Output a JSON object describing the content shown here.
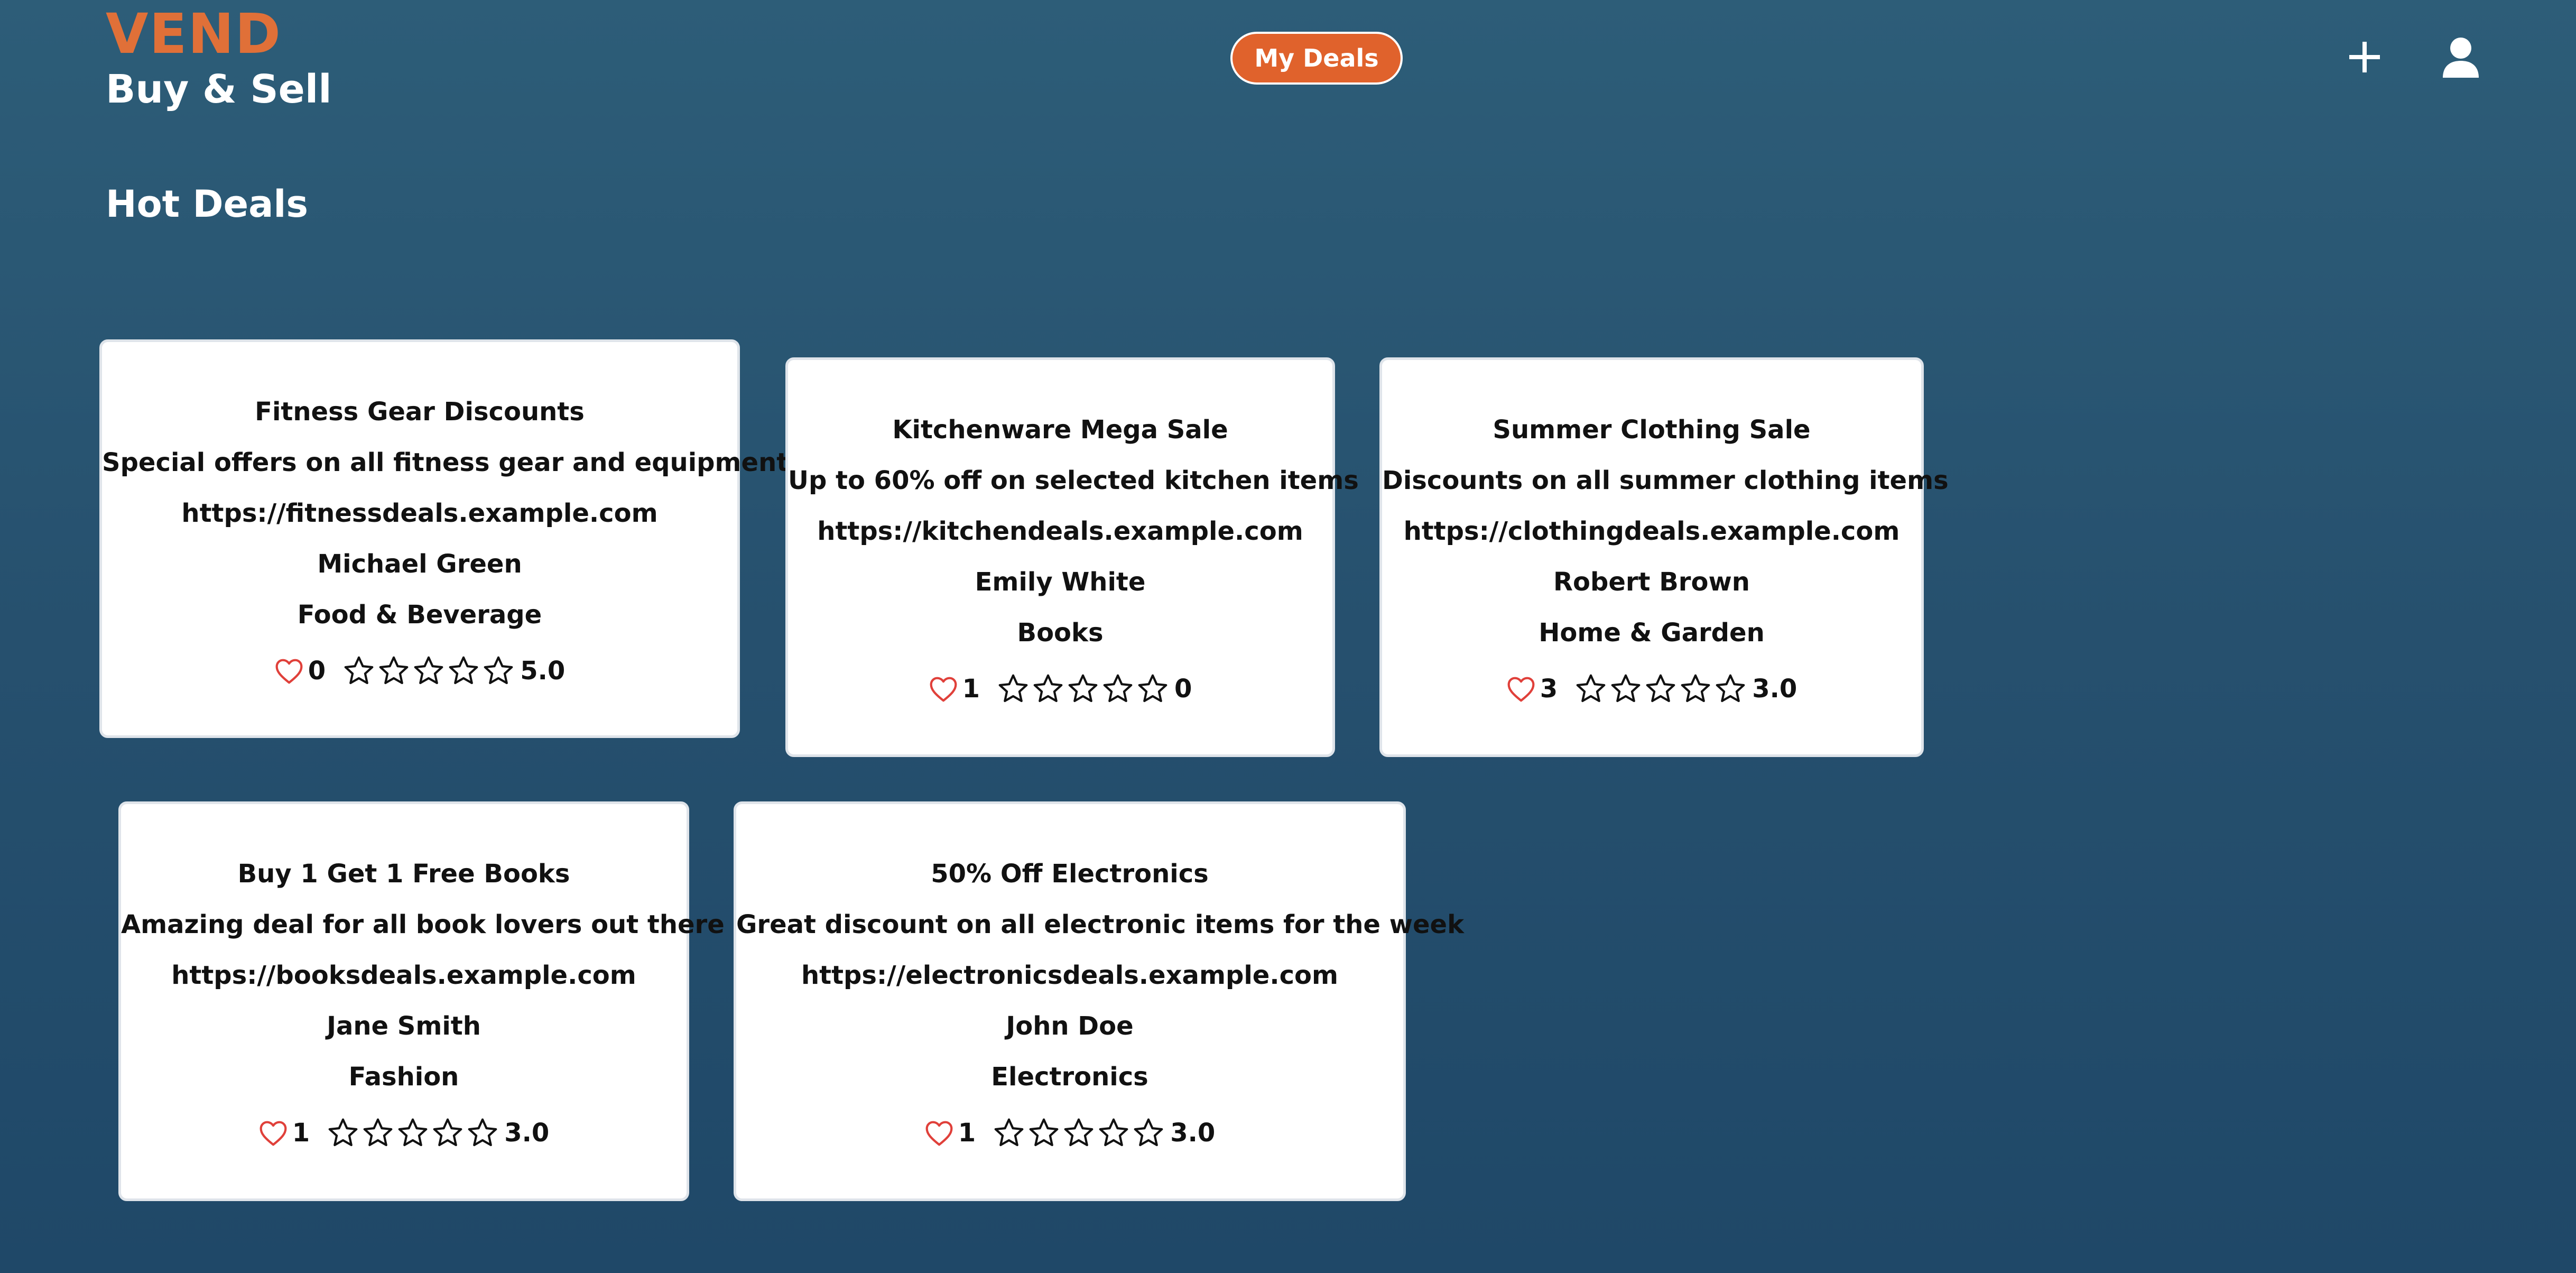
{
  "header": {
    "brand": "VEND",
    "tagline": "Buy & Sell",
    "my_deals_label": "My Deals",
    "add_icon": "plus-icon",
    "user_icon": "user-icon"
  },
  "section_title": "Hot Deals",
  "colors": {
    "accent": "#e0622c",
    "brand": "#e07038",
    "heart": "#e0403a",
    "background_top": "#2d5d78",
    "background_bottom": "#1f4868"
  },
  "deals": [
    {
      "title": "Fitness Gear Discounts",
      "description": "Special offers on all fitness gear and equipment",
      "url": "https://fitnessdeals.example.com",
      "author": "Michael Green",
      "category": "Food & Beverage",
      "likes": "0",
      "rating": "5.0"
    },
    {
      "title": "Kitchenware Mega Sale",
      "description": "Up to 60% off on selected kitchen items",
      "url": "https://kitchendeals.example.com",
      "author": "Emily White",
      "category": "Books",
      "likes": "1",
      "rating": "0"
    },
    {
      "title": "Summer Clothing Sale",
      "description": "Discounts on all summer clothing items",
      "url": "https://clothingdeals.example.com",
      "author": "Robert Brown",
      "category": "Home & Garden",
      "likes": "3",
      "rating": "3.0"
    },
    {
      "title": "Buy 1 Get 1 Free Books",
      "description": "Amazing deal for all book lovers out there",
      "url": "https://booksdeals.example.com",
      "author": "Jane Smith",
      "category": "Fashion",
      "likes": "1",
      "rating": "3.0"
    },
    {
      "title": "50% Off Electronics",
      "description": "Great discount on all electronic items for the week",
      "url": "https://electronicsdeals.example.com",
      "author": "John Doe",
      "category": "Electronics",
      "likes": "1",
      "rating": "3.0"
    }
  ]
}
